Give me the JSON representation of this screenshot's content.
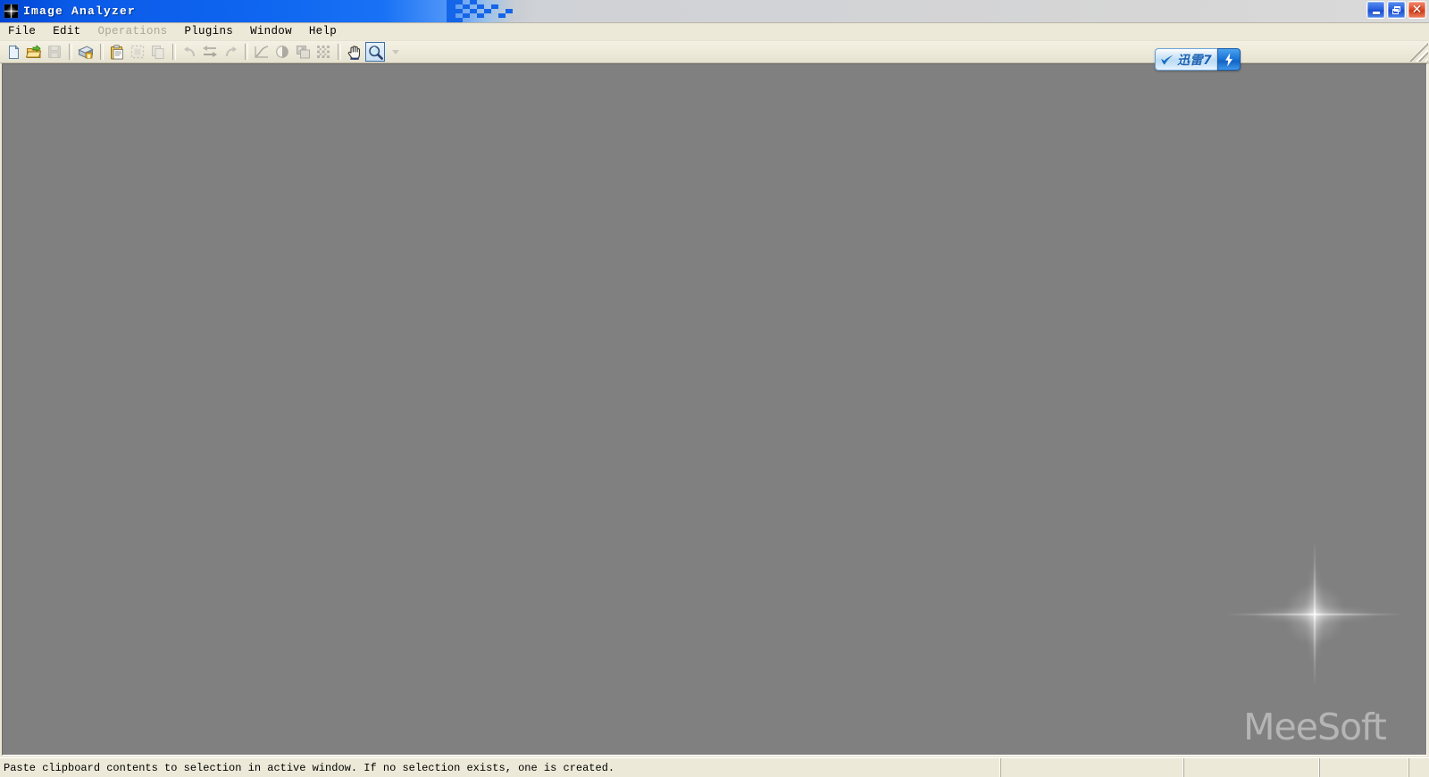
{
  "window": {
    "title": "Image Analyzer",
    "icon": "sparkle-star-icon",
    "controls": {
      "minimize_label": "Minimize",
      "restore_label": "Restore",
      "close_label": "Close"
    }
  },
  "menubar": {
    "items": [
      {
        "label": "File",
        "disabled": false
      },
      {
        "label": "Edit",
        "disabled": false
      },
      {
        "label": "Operations",
        "disabled": true
      },
      {
        "label": "Plugins",
        "disabled": false
      },
      {
        "label": "Window",
        "disabled": false
      },
      {
        "label": "Help",
        "disabled": false
      }
    ]
  },
  "toolbar": {
    "buttons": [
      {
        "name": "new-file-icon",
        "label": "New",
        "disabled": false,
        "active": false
      },
      {
        "name": "open-folder-icon",
        "label": "Open",
        "disabled": false,
        "active": false
      },
      {
        "name": "save-icon",
        "label": "Save",
        "disabled": true,
        "active": false
      },
      {
        "name": "scanner-acquire-icon",
        "label": "Acquire / Scan",
        "disabled": false,
        "active": false
      },
      {
        "name": "paste-clipboard-icon",
        "label": "Paste",
        "disabled": false,
        "active": false
      },
      {
        "name": "cut-selection-icon",
        "label": "Cut",
        "disabled": true,
        "active": false
      },
      {
        "name": "copy-icon",
        "label": "Copy",
        "disabled": true,
        "active": false
      },
      {
        "name": "undo-icon",
        "label": "Undo",
        "disabled": true,
        "active": false
      },
      {
        "name": "flip-mirror-icon",
        "label": "Flip / Mirror",
        "disabled": true,
        "active": false
      },
      {
        "name": "redo-icon",
        "label": "Redo",
        "disabled": true,
        "active": false
      },
      {
        "name": "curves-icon",
        "label": "Curves",
        "disabled": true,
        "active": false
      },
      {
        "name": "brightness-contrast-icon",
        "label": "Brightness / Contrast",
        "disabled": true,
        "active": false
      },
      {
        "name": "resize-image-icon",
        "label": "Resize",
        "disabled": true,
        "active": false
      },
      {
        "name": "dither-grid-icon",
        "label": "Dither / Grid",
        "disabled": true,
        "active": false
      },
      {
        "name": "pan-hand-icon",
        "label": "Pan",
        "disabled": false,
        "active": false
      },
      {
        "name": "zoom-magnifier-icon",
        "label": "Zoom",
        "disabled": false,
        "active": true
      },
      {
        "name": "toolbar-overflow-icon",
        "label": "More",
        "disabled": true,
        "active": false
      }
    ],
    "grip_label": "Toolbar resize grip"
  },
  "overlay_widget": {
    "name": "xunlei-7-widget",
    "label": "迅雷7",
    "bird_icon": "xunlei-bird-icon",
    "action_icon": "lightning-bolt-icon"
  },
  "workspace": {
    "background_color": "#808080",
    "watermark_text": "MeeSoft",
    "watermark_icon": "sparkle-star-watermark"
  },
  "statusbar": {
    "hint": "Paste clipboard contents to selection in active window.   If no selection exists, one is created.",
    "panel2": "",
    "panel3": "",
    "panel4": "",
    "panel5": ""
  },
  "colors": {
    "title_blue": "#0f66f0",
    "face": "#ece9d8",
    "workspace_gray": "#808080",
    "accent_blue": "#1c63b4",
    "close_red": "#cf3a17"
  }
}
